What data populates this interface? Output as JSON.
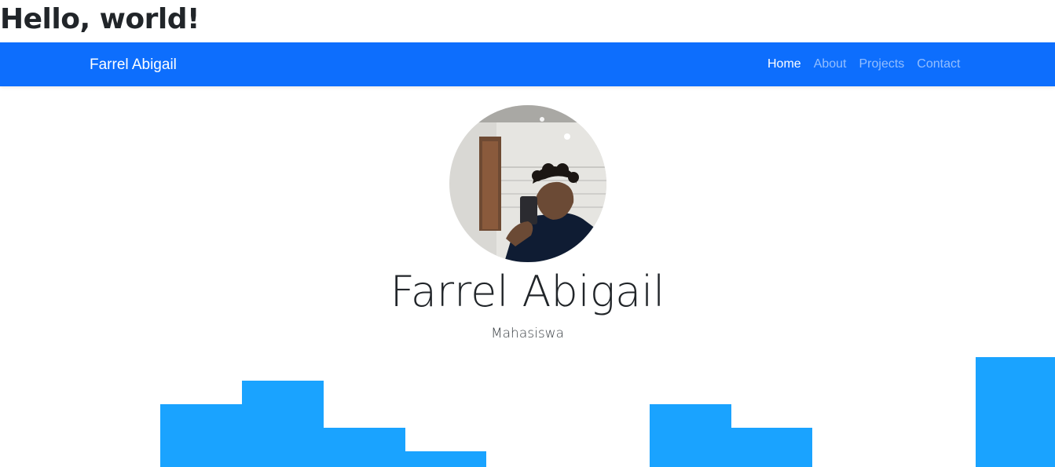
{
  "page": {
    "heading": "Hello, world!"
  },
  "navbar": {
    "brand": "Farrel Abigail",
    "links": [
      {
        "label": "Home",
        "active": true
      },
      {
        "label": "About",
        "active": false
      },
      {
        "label": "Projects",
        "active": false
      },
      {
        "label": "Contact",
        "active": false
      }
    ],
    "background_color": "#0d6efd"
  },
  "hero": {
    "name": "Farrel Abigail",
    "role": "Mahasiswa",
    "avatar_icon": "profile-photo"
  },
  "decoration": {
    "wave_color": "#1aa3ff"
  }
}
